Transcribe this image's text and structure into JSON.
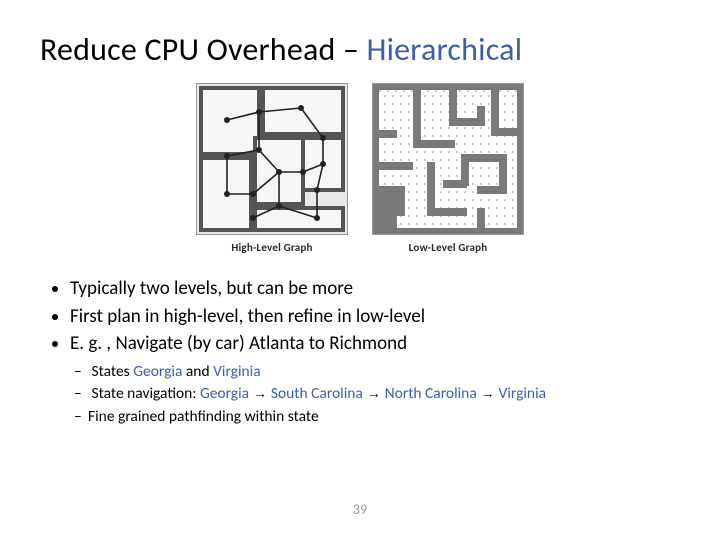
{
  "title_plain": "Reduce CPU Overhead ",
  "title_dash": "– ",
  "title_accent": "Hierarchical",
  "captions": {
    "high": "High-Level Graph",
    "low": "Low-Level Graph"
  },
  "bullets": {
    "b1": "Typically two levels, but can be more",
    "b2": "First plan in high-level, then refine in low-level",
    "b3": "E. g. , Navigate (by car) Atlanta to Richmond",
    "sub1_a": "States ",
    "sub1_g": "Georgia",
    "sub1_b": " and ",
    "sub1_v": "Virginia",
    "sub2_a": "State navigation: ",
    "sub2_g": "Georgia",
    "sub2_sc": "South Carolina",
    "sub2_nc": "North Carolina",
    "sub2_v": "Virginia",
    "sub3": "Fine grained pathfinding within state"
  },
  "arrow": " → ",
  "page": "39"
}
